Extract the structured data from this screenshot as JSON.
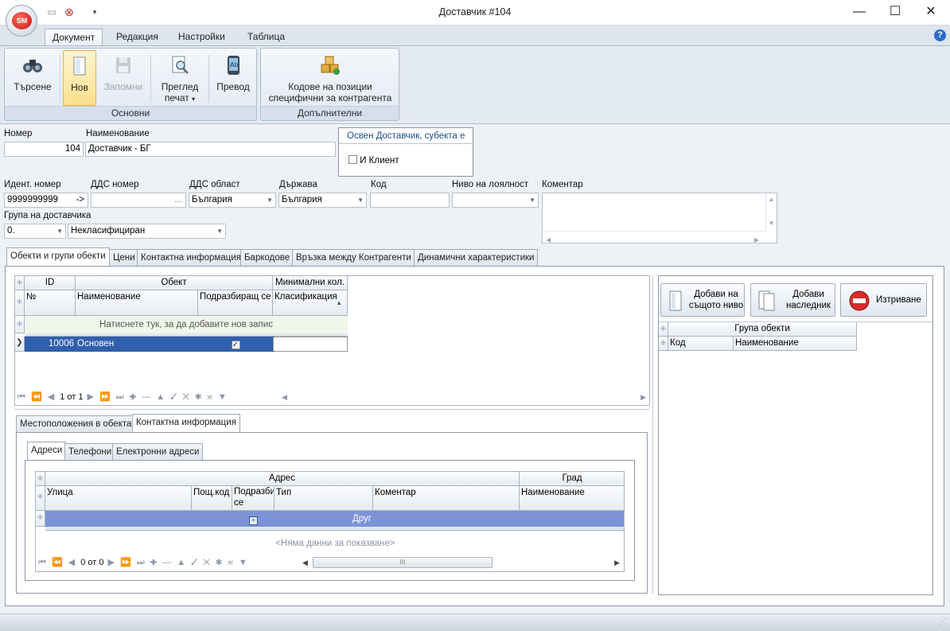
{
  "window": {
    "title": "Доставчик #104",
    "minimize": "—",
    "maximize": "☐",
    "close": "✕"
  },
  "app": {
    "orb_text": "SM"
  },
  "ribbon": {
    "tabs": [
      "Документ",
      "Редакция",
      "Настройки",
      "Таблица"
    ],
    "active_tab": 0,
    "groups": {
      "main": {
        "label": "Основни",
        "search": "Търсене",
        "new": "Нов",
        "save": "Запомни",
        "preview_line1": "Преглед",
        "preview_line2": "печат",
        "translate": "Превод"
      },
      "extra": {
        "label": "Допълнителни",
        "codes_line1": "Кодове на позиции",
        "codes_line2": "специфични за контрагента"
      }
    }
  },
  "form": {
    "number_label": "Номер",
    "number_value": "104",
    "name_label": "Наименование",
    "name_value": "Доставчик - БГ",
    "besides_title": "Освен Доставчик, субекта е",
    "client_label": "И Клиент",
    "ident_label": "Идент. номер",
    "ident_value": "9999999999",
    "ident_arrow": "->",
    "vat_label": "ДДС номер",
    "vat_value": "",
    "vat_dots": "...",
    "vat_region_label": "ДДС област",
    "vat_region_value": "България",
    "country_label": "Държава",
    "country_value": "България",
    "code_label": "Код",
    "code_value": "",
    "loyalty_label": "Ниво на лоялност",
    "loyalty_value": "",
    "comment_label": "Коментар",
    "comment_value": "",
    "group_label": "Група на доставчика",
    "group_code": "0.",
    "group_name": "Некласифициран"
  },
  "tabs_main": [
    "Обекти и групи обекти",
    "Цени",
    "Контактна информация",
    "Баркодове",
    "Връзка между Контрагенти",
    "Динамични характеристики"
  ],
  "objects_grid": {
    "band_id": "ID",
    "band_object": "Обект",
    "band_min": "Минимални кол.",
    "col_no": "№",
    "col_name": "Наименование",
    "col_sub": "Подразбиращ се",
    "col_class": "Класификация",
    "new_row_hint": "Натиснете тук, за да добавите нов запис",
    "rows": [
      {
        "id": "10006",
        "name": "Основен",
        "default": true,
        "class": ""
      }
    ],
    "pager": "1 от 1"
  },
  "right_panel": {
    "add_same_line1": "Добави на",
    "add_same_line2": "същото ниво",
    "add_child_line1": "Добави",
    "add_child_line2": "наследник",
    "delete": "Изтриване",
    "grid_band": "Група обекти",
    "col_code": "Код",
    "col_name": "Наименование"
  },
  "sub_tabs": [
    "Местоположения в обекта",
    "Контактна информация"
  ],
  "contact_tabs": [
    "Адреси",
    "Телефони",
    "Електронни адреси"
  ],
  "address_grid": {
    "band_address": "Адрес",
    "band_city": "Град",
    "col_street": "Улица",
    "col_zip": "Пощ.код",
    "col_default": "Подразбиращ се",
    "col_type": "Тип",
    "col_comment": "Коментар",
    "col_city_name": "Наименование",
    "row_type": "Друг",
    "empty_text": "<Няма данни за показване>",
    "pager": "0 от 0",
    "scroll_grip": "III"
  }
}
